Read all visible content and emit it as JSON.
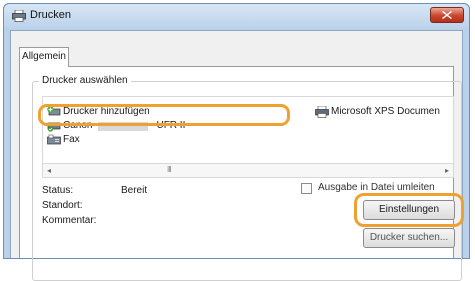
{
  "window": {
    "title": "Drucken",
    "close_label": "Close"
  },
  "tabs": [
    {
      "label": "Allgemein",
      "selected": true
    }
  ],
  "printer_group": {
    "legend": "Drucker auswählen",
    "printers": [
      {
        "label": "Drucker hinzufügen",
        "icon": "add-printer-icon"
      },
      {
        "label": "Microsoft XPS Documen",
        "icon": "printer-icon"
      },
      {
        "label_prefix": "Canon",
        "label_suffix": "UFR II",
        "icon": "printer-icon",
        "selected": true
      },
      {
        "label": "Fax",
        "icon": "fax-icon"
      }
    ],
    "scroll": {
      "left_arrow": "◂",
      "grip": "III",
      "right_arrow": "▸"
    }
  },
  "details": {
    "status_label": "Status:",
    "status_value": "Bereit",
    "location_label": "Standort:",
    "location_value": "",
    "comment_label": "Kommentar:",
    "comment_value": ""
  },
  "print_to_file": {
    "label": "Ausgabe in Datei umleiten",
    "checked": false
  },
  "buttons": {
    "settings": "Einstellungen",
    "find_printer": "Drucker suchen..."
  },
  "colors": {
    "highlight": "#f0a030",
    "title_bar": "#bcd3ea",
    "close_button": "#c9462c"
  }
}
